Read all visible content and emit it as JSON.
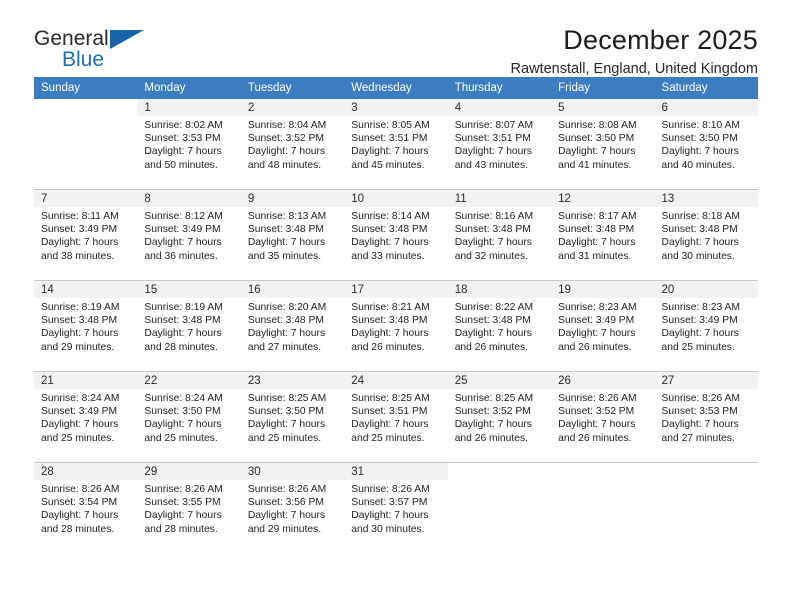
{
  "brand": {
    "name_part1": "General",
    "name_part2": "Blue",
    "triangle_icon": "triangle-icon",
    "accent_color": "#1565a8"
  },
  "header": {
    "month_title": "December 2025",
    "location": "Rawtenstall, England, United Kingdom"
  },
  "calendar": {
    "header_bg": "#3b7dc0",
    "daynum_bg": "#f2f2f2",
    "weekdays": [
      "Sunday",
      "Monday",
      "Tuesday",
      "Wednesday",
      "Thursday",
      "Friday",
      "Saturday"
    ],
    "weeks": [
      [
        {
          "day": "",
          "sunrise": "",
          "sunset": "",
          "daylight_line1": "",
          "daylight_line2": ""
        },
        {
          "day": "1",
          "sunrise": "Sunrise: 8:02 AM",
          "sunset": "Sunset: 3:53 PM",
          "daylight_line1": "Daylight: 7 hours",
          "daylight_line2": "and 50 minutes."
        },
        {
          "day": "2",
          "sunrise": "Sunrise: 8:04 AM",
          "sunset": "Sunset: 3:52 PM",
          "daylight_line1": "Daylight: 7 hours",
          "daylight_line2": "and 48 minutes."
        },
        {
          "day": "3",
          "sunrise": "Sunrise: 8:05 AM",
          "sunset": "Sunset: 3:51 PM",
          "daylight_line1": "Daylight: 7 hours",
          "daylight_line2": "and 45 minutes."
        },
        {
          "day": "4",
          "sunrise": "Sunrise: 8:07 AM",
          "sunset": "Sunset: 3:51 PM",
          "daylight_line1": "Daylight: 7 hours",
          "daylight_line2": "and 43 minutes."
        },
        {
          "day": "5",
          "sunrise": "Sunrise: 8:08 AM",
          "sunset": "Sunset: 3:50 PM",
          "daylight_line1": "Daylight: 7 hours",
          "daylight_line2": "and 41 minutes."
        },
        {
          "day": "6",
          "sunrise": "Sunrise: 8:10 AM",
          "sunset": "Sunset: 3:50 PM",
          "daylight_line1": "Daylight: 7 hours",
          "daylight_line2": "and 40 minutes."
        }
      ],
      [
        {
          "day": "7",
          "sunrise": "Sunrise: 8:11 AM",
          "sunset": "Sunset: 3:49 PM",
          "daylight_line1": "Daylight: 7 hours",
          "daylight_line2": "and 38 minutes."
        },
        {
          "day": "8",
          "sunrise": "Sunrise: 8:12 AM",
          "sunset": "Sunset: 3:49 PM",
          "daylight_line1": "Daylight: 7 hours",
          "daylight_line2": "and 36 minutes."
        },
        {
          "day": "9",
          "sunrise": "Sunrise: 8:13 AM",
          "sunset": "Sunset: 3:48 PM",
          "daylight_line1": "Daylight: 7 hours",
          "daylight_line2": "and 35 minutes."
        },
        {
          "day": "10",
          "sunrise": "Sunrise: 8:14 AM",
          "sunset": "Sunset: 3:48 PM",
          "daylight_line1": "Daylight: 7 hours",
          "daylight_line2": "and 33 minutes."
        },
        {
          "day": "11",
          "sunrise": "Sunrise: 8:16 AM",
          "sunset": "Sunset: 3:48 PM",
          "daylight_line1": "Daylight: 7 hours",
          "daylight_line2": "and 32 minutes."
        },
        {
          "day": "12",
          "sunrise": "Sunrise: 8:17 AM",
          "sunset": "Sunset: 3:48 PM",
          "daylight_line1": "Daylight: 7 hours",
          "daylight_line2": "and 31 minutes."
        },
        {
          "day": "13",
          "sunrise": "Sunrise: 8:18 AM",
          "sunset": "Sunset: 3:48 PM",
          "daylight_line1": "Daylight: 7 hours",
          "daylight_line2": "and 30 minutes."
        }
      ],
      [
        {
          "day": "14",
          "sunrise": "Sunrise: 8:19 AM",
          "sunset": "Sunset: 3:48 PM",
          "daylight_line1": "Daylight: 7 hours",
          "daylight_line2": "and 29 minutes."
        },
        {
          "day": "15",
          "sunrise": "Sunrise: 8:19 AM",
          "sunset": "Sunset: 3:48 PM",
          "daylight_line1": "Daylight: 7 hours",
          "daylight_line2": "and 28 minutes."
        },
        {
          "day": "16",
          "sunrise": "Sunrise: 8:20 AM",
          "sunset": "Sunset: 3:48 PM",
          "daylight_line1": "Daylight: 7 hours",
          "daylight_line2": "and 27 minutes."
        },
        {
          "day": "17",
          "sunrise": "Sunrise: 8:21 AM",
          "sunset": "Sunset: 3:48 PM",
          "daylight_line1": "Daylight: 7 hours",
          "daylight_line2": "and 26 minutes."
        },
        {
          "day": "18",
          "sunrise": "Sunrise: 8:22 AM",
          "sunset": "Sunset: 3:48 PM",
          "daylight_line1": "Daylight: 7 hours",
          "daylight_line2": "and 26 minutes."
        },
        {
          "day": "19",
          "sunrise": "Sunrise: 8:23 AM",
          "sunset": "Sunset: 3:49 PM",
          "daylight_line1": "Daylight: 7 hours",
          "daylight_line2": "and 26 minutes."
        },
        {
          "day": "20",
          "sunrise": "Sunrise: 8:23 AM",
          "sunset": "Sunset: 3:49 PM",
          "daylight_line1": "Daylight: 7 hours",
          "daylight_line2": "and 25 minutes."
        }
      ],
      [
        {
          "day": "21",
          "sunrise": "Sunrise: 8:24 AM",
          "sunset": "Sunset: 3:49 PM",
          "daylight_line1": "Daylight: 7 hours",
          "daylight_line2": "and 25 minutes."
        },
        {
          "day": "22",
          "sunrise": "Sunrise: 8:24 AM",
          "sunset": "Sunset: 3:50 PM",
          "daylight_line1": "Daylight: 7 hours",
          "daylight_line2": "and 25 minutes."
        },
        {
          "day": "23",
          "sunrise": "Sunrise: 8:25 AM",
          "sunset": "Sunset: 3:50 PM",
          "daylight_line1": "Daylight: 7 hours",
          "daylight_line2": "and 25 minutes."
        },
        {
          "day": "24",
          "sunrise": "Sunrise: 8:25 AM",
          "sunset": "Sunset: 3:51 PM",
          "daylight_line1": "Daylight: 7 hours",
          "daylight_line2": "and 25 minutes."
        },
        {
          "day": "25",
          "sunrise": "Sunrise: 8:25 AM",
          "sunset": "Sunset: 3:52 PM",
          "daylight_line1": "Daylight: 7 hours",
          "daylight_line2": "and 26 minutes."
        },
        {
          "day": "26",
          "sunrise": "Sunrise: 8:26 AM",
          "sunset": "Sunset: 3:52 PM",
          "daylight_line1": "Daylight: 7 hours",
          "daylight_line2": "and 26 minutes."
        },
        {
          "day": "27",
          "sunrise": "Sunrise: 8:26 AM",
          "sunset": "Sunset: 3:53 PM",
          "daylight_line1": "Daylight: 7 hours",
          "daylight_line2": "and 27 minutes."
        }
      ],
      [
        {
          "day": "28",
          "sunrise": "Sunrise: 8:26 AM",
          "sunset": "Sunset: 3:54 PM",
          "daylight_line1": "Daylight: 7 hours",
          "daylight_line2": "and 28 minutes."
        },
        {
          "day": "29",
          "sunrise": "Sunrise: 8:26 AM",
          "sunset": "Sunset: 3:55 PM",
          "daylight_line1": "Daylight: 7 hours",
          "daylight_line2": "and 28 minutes."
        },
        {
          "day": "30",
          "sunrise": "Sunrise: 8:26 AM",
          "sunset": "Sunset: 3:56 PM",
          "daylight_line1": "Daylight: 7 hours",
          "daylight_line2": "and 29 minutes."
        },
        {
          "day": "31",
          "sunrise": "Sunrise: 8:26 AM",
          "sunset": "Sunset: 3:57 PM",
          "daylight_line1": "Daylight: 7 hours",
          "daylight_line2": "and 30 minutes."
        },
        {
          "day": "",
          "sunrise": "",
          "sunset": "",
          "daylight_line1": "",
          "daylight_line2": ""
        },
        {
          "day": "",
          "sunrise": "",
          "sunset": "",
          "daylight_line1": "",
          "daylight_line2": ""
        },
        {
          "day": "",
          "sunrise": "",
          "sunset": "",
          "daylight_line1": "",
          "daylight_line2": ""
        }
      ]
    ]
  }
}
